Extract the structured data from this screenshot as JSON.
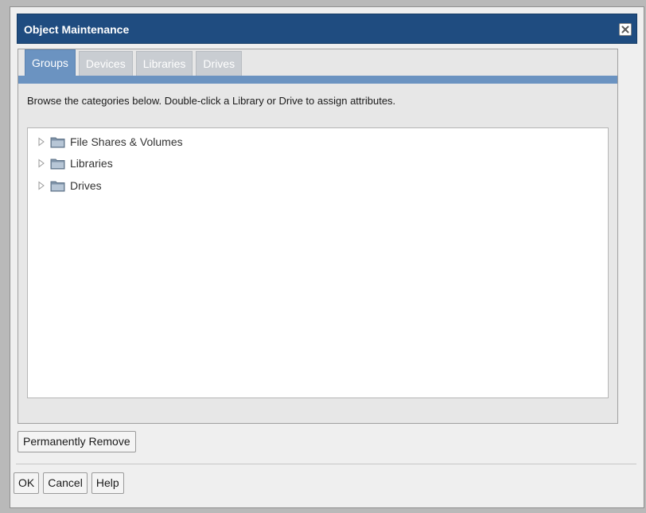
{
  "dialog": {
    "title": "Object Maintenance",
    "close_icon": "close-icon",
    "colors": {
      "titlebar": "#1f4c80",
      "active_tab": "#6b93c1",
      "inactive_tab": "#c9cdd2"
    }
  },
  "tabs": [
    {
      "label": "Groups",
      "active": true
    },
    {
      "label": "Devices",
      "active": false
    },
    {
      "label": "Libraries",
      "active": false
    },
    {
      "label": "Drives",
      "active": false
    }
  ],
  "instructions": "Browse the categories below. Double-click a Library or Drive to assign attributes.",
  "tree": {
    "items": [
      {
        "label": "File Shares & Volumes",
        "icon": "folder-icon",
        "expander": "expand-arrow-icon"
      },
      {
        "label": "Libraries",
        "icon": "folder-icon",
        "expander": "expand-arrow-icon"
      },
      {
        "label": "Drives",
        "icon": "folder-icon",
        "expander": "expand-arrow-icon"
      }
    ]
  },
  "buttons": {
    "permanently_remove": "Permanently Remove",
    "ok": "OK",
    "cancel": "Cancel",
    "help": "Help"
  }
}
